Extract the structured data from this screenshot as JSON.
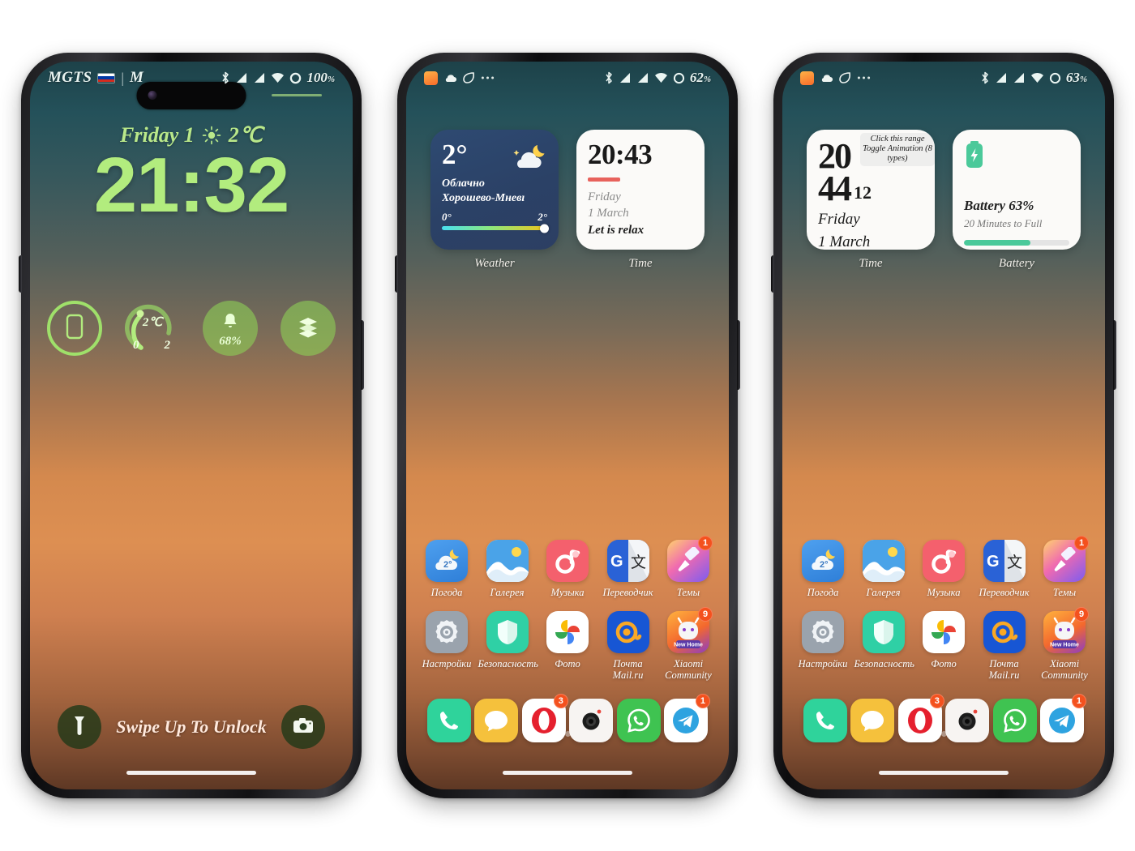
{
  "colors": {
    "lock_accent": "#b2ec7e",
    "badge": "#f4511e",
    "battery_green": "#4bc99a",
    "widget_blue": "#2e4a72",
    "red_line": "#e8625c"
  },
  "phone1": {
    "name": "lock-screen",
    "statusbar": {
      "carrier": "MGTS",
      "carrier_separator": "|",
      "carrier_second": "M",
      "flag": "ru-flag-icon",
      "icons": [
        "bluetooth-icon",
        "signal-icon",
        "signal-icon",
        "wifi-icon",
        "battery-ring-icon"
      ],
      "battery": "100",
      "battery_unit": "%"
    },
    "lock": {
      "date": "Friday 1",
      "weather_icon": "sun-icon",
      "temp": "2℃",
      "clock": "21:32",
      "toggles": [
        {
          "name": "device-toggle",
          "icon": "phone-outline-icon",
          "label": ""
        },
        {
          "name": "temperature-toggle",
          "icon": "arc-gauge-icon",
          "value": "2℃",
          "min": "0",
          "max": "2"
        },
        {
          "name": "notification-toggle",
          "icon": "bell-icon",
          "value": "68%"
        },
        {
          "name": "layers-toggle",
          "icon": "layers-icon",
          "label": ""
        }
      ],
      "flashlight_icon": "flashlight-icon",
      "camera_icon": "camera-icon",
      "swipe_text": "Swipe Up To Unlock"
    }
  },
  "phone2": {
    "name": "home-screen-widgets",
    "statusbar": {
      "notif_icons": [
        "app-orange-icon",
        "cloud-icon",
        "leaf-icon",
        "more-icon"
      ],
      "icons": [
        "bluetooth-icon",
        "signal-icon",
        "signal-icon",
        "wifi-icon",
        "battery-moon-icon"
      ],
      "battery": "62",
      "battery_unit": "%"
    },
    "widgets": [
      {
        "label": "Weather",
        "temp": "2°",
        "condition": "Облачно",
        "location": "Хорошево-Мневı",
        "range_min": "0°",
        "range_max": "2°",
        "icon": "cloud-moon-icon"
      },
      {
        "label": "Time",
        "clock": "20:43",
        "day": "Friday",
        "date": "1 March",
        "message": "Let is relax"
      }
    ]
  },
  "phone3": {
    "name": "home-screen-widgets-alt",
    "statusbar": {
      "notif_icons": [
        "app-orange-icon",
        "cloud-icon",
        "leaf-icon",
        "more-icon"
      ],
      "icons": [
        "bluetooth-icon",
        "signal-icon",
        "signal-icon",
        "wifi-icon",
        "battery-moon-icon"
      ],
      "battery": "63",
      "battery_unit": "%"
    },
    "widgets": [
      {
        "label": "Time",
        "hour": "20",
        "minute": "44",
        "second": "12",
        "note": "Click this range Toggle Animation (8 types)",
        "day": "Friday",
        "date": "1 March"
      },
      {
        "label": "Battery",
        "icon": "battery-charging-icon",
        "title": "Battery 63%",
        "subtitle": "20 Minutes to Full",
        "percent": 63
      }
    ]
  },
  "apps": {
    "row1": [
      {
        "label": "Погода",
        "icon": "weather-app-icon",
        "badge": ""
      },
      {
        "label": "Галерея",
        "icon": "gallery-app-icon",
        "badge": ""
      },
      {
        "label": "Музыка",
        "icon": "music-app-icon",
        "badge": ""
      },
      {
        "label": "Переводчик",
        "icon": "translate-app-icon",
        "badge": ""
      },
      {
        "label": "Темы",
        "icon": "themes-app-icon",
        "badge": "1"
      }
    ],
    "row2": [
      {
        "label": "Настройки",
        "icon": "settings-app-icon",
        "badge": ""
      },
      {
        "label": "Безопасность",
        "icon": "security-app-icon",
        "badge": ""
      },
      {
        "label": "Фото",
        "icon": "photos-app-icon",
        "badge": ""
      },
      {
        "label": "Почта Mail.ru",
        "icon": "mailru-app-icon",
        "badge": ""
      },
      {
        "label": "Xiaomi Community",
        "icon": "xiaomi-app-icon",
        "badge": "9",
        "ribbon": "New Home"
      }
    ],
    "dock": [
      {
        "name": "phone",
        "icon": "phone-app-icon",
        "badge": ""
      },
      {
        "name": "messages",
        "icon": "messages-app-icon",
        "badge": ""
      },
      {
        "name": "opera",
        "icon": "opera-app-icon",
        "badge": "3"
      },
      {
        "name": "camera",
        "icon": "camera-app-icon",
        "badge": ""
      },
      {
        "name": "whatsapp",
        "icon": "whatsapp-app-icon",
        "badge": ""
      },
      {
        "name": "telegram",
        "icon": "telegram-app-icon",
        "badge": "1"
      }
    ],
    "page_dots": 3,
    "active_page": 0
  }
}
